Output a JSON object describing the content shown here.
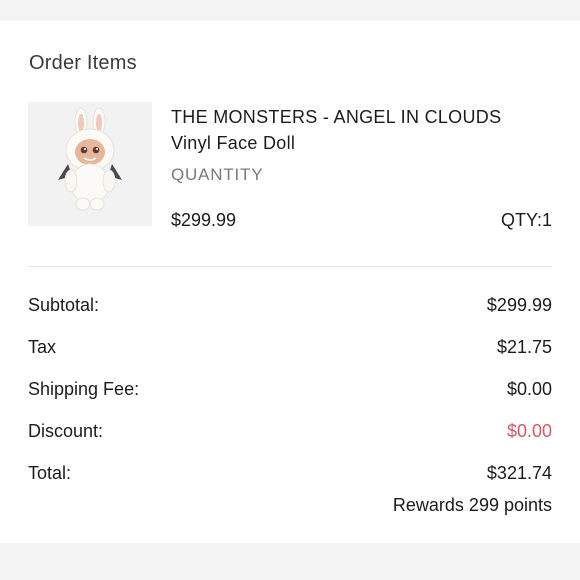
{
  "order": {
    "section_title": "Order Items",
    "item": {
      "image_icon": "figure-doll-image",
      "name_line1": "THE MONSTERS - ANGEL IN CLOUDS",
      "name_line2": "Vinyl Face Doll",
      "quantity_label": "QUANTITY",
      "price": "$299.99",
      "qty": "QTY:1"
    },
    "summary": {
      "subtotal_label": "Subtotal:",
      "subtotal_value": "$299.99",
      "tax_label": "Tax",
      "tax_value": "$21.75",
      "shipping_label": "Shipping Fee:",
      "shipping_value": "$0.00",
      "discount_label": "Discount:",
      "discount_value": "$0.00",
      "total_label": "Total:",
      "total_value": "$321.74",
      "rewards": "Rewards 299 points"
    }
  },
  "colors": {
    "background": "#f3f3f3",
    "card": "#ffffff",
    "discount": "#cf5a6a",
    "muted": "#7a7a7a"
  }
}
